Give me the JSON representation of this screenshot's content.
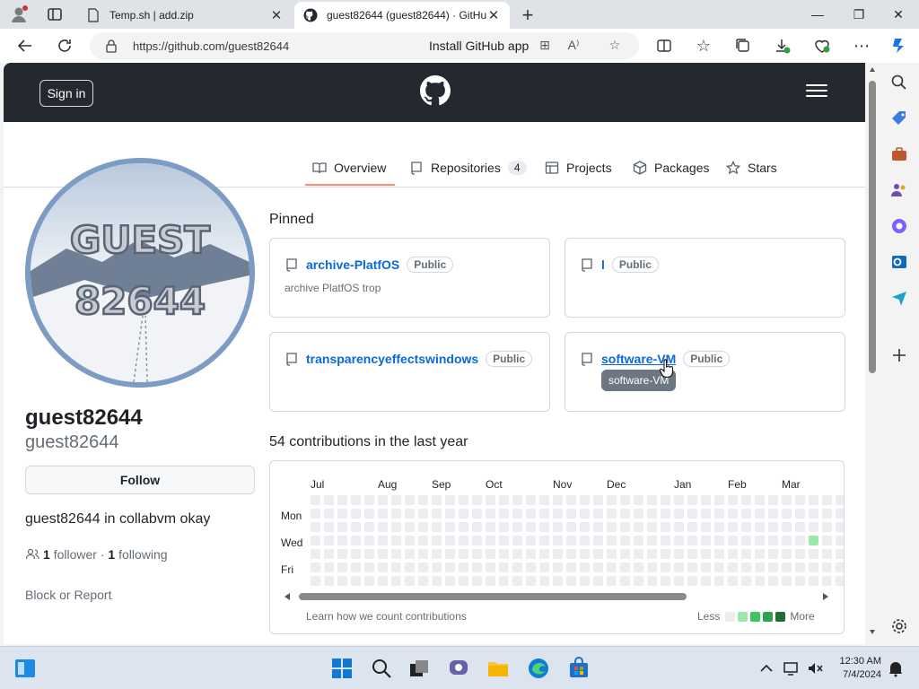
{
  "browser": {
    "tabs": [
      {
        "title": "Temp.sh | add.zip",
        "icon": "document-icon"
      },
      {
        "title": "guest82644 (guest82644) · GitHub",
        "icon": "github-icon"
      }
    ],
    "url": "https://github.com/guest82644",
    "install_app": "Install GitHub app"
  },
  "header": {
    "sign_in": "Sign in"
  },
  "nav": {
    "tabs": [
      {
        "label": "Overview",
        "icon": "book-icon"
      },
      {
        "label": "Repositories",
        "icon": "repo-icon",
        "count": "4"
      },
      {
        "label": "Projects",
        "icon": "table-icon"
      },
      {
        "label": "Packages",
        "icon": "package-icon"
      },
      {
        "label": "Stars",
        "icon": "star-icon"
      }
    ]
  },
  "profile": {
    "avatar_text_line1": "GUEST",
    "avatar_text_line2": "82644",
    "name": "guest82644",
    "login": "guest82644",
    "follow": "Follow",
    "bio": "guest82644 in collabvm okay",
    "followers_count": "1",
    "followers_label": "follower",
    "separator": "·",
    "following_count": "1",
    "following_label": "following",
    "block": "Block or Report"
  },
  "pinned": {
    "heading": "Pinned",
    "cards": [
      {
        "name": "archive-PlatfOS",
        "visibility": "Public",
        "description": "archive PlatfOS trop"
      },
      {
        "name": "l",
        "visibility": "Public",
        "description": ""
      },
      {
        "name": "transparencyeffectswindows",
        "visibility": "Public",
        "description": ""
      },
      {
        "name": "software-VM",
        "visibility": "Public",
        "description": ""
      }
    ],
    "tooltip": "software-VM"
  },
  "contributions": {
    "heading": "54 contributions in the last year",
    "months": [
      "Jul",
      "Aug",
      "Sep",
      "Oct",
      "Nov",
      "Dec",
      "Jan",
      "Feb",
      "Mar"
    ],
    "days": [
      "Mon",
      "Wed",
      "Fri"
    ],
    "learn": "Learn how we count contributions",
    "less": "Less",
    "more": "More",
    "legend_colors": [
      "#ebedf0",
      "#9be9a8",
      "#40c463",
      "#30a14e",
      "#216e39"
    ],
    "active_cell": {
      "week": 37,
      "day": 3,
      "level": 1
    }
  },
  "taskbar": {
    "time": "12:30 AM",
    "date": "7/4/2024"
  },
  "colors": {
    "header_bg": "#24292f",
    "link": "#0969da",
    "tab_underline": "#fd8c73"
  }
}
